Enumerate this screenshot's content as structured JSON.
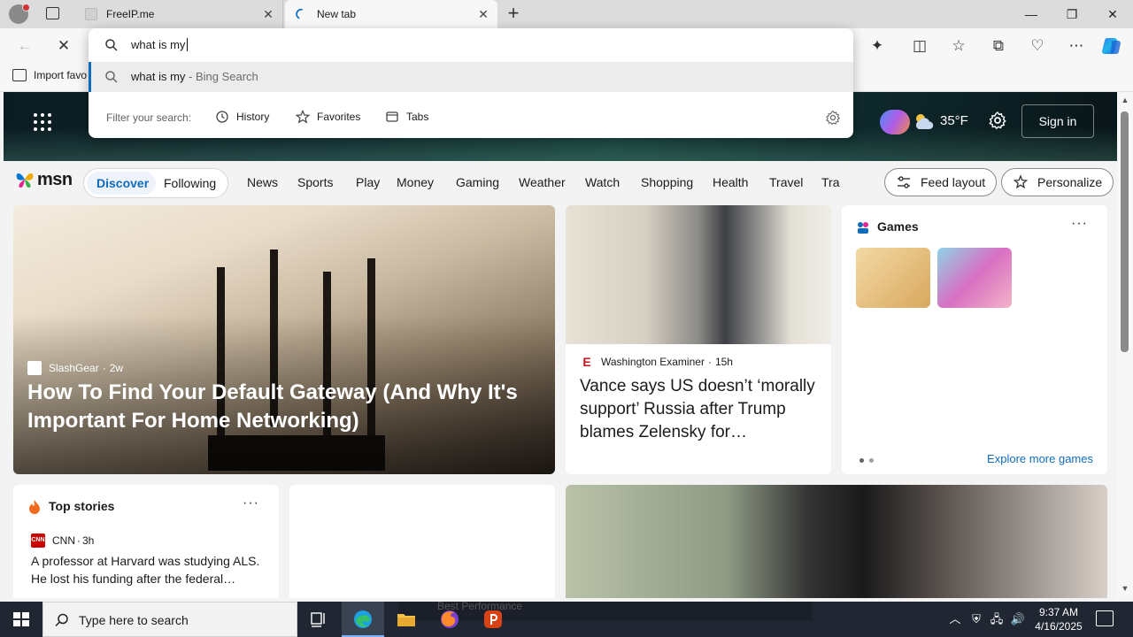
{
  "browser": {
    "tabs": [
      {
        "title": "FreeIP.me"
      },
      {
        "title": "New tab"
      }
    ],
    "favorites_bar": {
      "import_label": "Import favo"
    }
  },
  "omnibox": {
    "query": "what is my",
    "suggestion": {
      "query": "what is my",
      "suffix": " - Bing Search"
    },
    "filter_label": "Filter your search:",
    "filters": [
      {
        "label": "History",
        "icon": "history-icon"
      },
      {
        "label": "Favorites",
        "icon": "star-icon"
      },
      {
        "label": "Tabs",
        "icon": "tabs-icon"
      }
    ]
  },
  "msn": {
    "logo": "msn",
    "weather": {
      "temp": "35°F"
    },
    "signin_label": "Sign in",
    "segment": {
      "active": "Discover",
      "inactive": "Following"
    },
    "nav": [
      "News",
      "Sports",
      "Play",
      "Money",
      "Gaming",
      "Weather",
      "Watch",
      "Shopping",
      "Health",
      "Travel",
      "Tra"
    ],
    "feed_layout_label": "Feed layout",
    "personalize_label": "Personalize",
    "main_story": {
      "source": "SlashGear",
      "age": "2w",
      "headline": "How To Find Your Default Gateway (And Why It's Important For Home Networking)"
    },
    "news_story": {
      "source": "Washington Examiner",
      "age": "15h",
      "headline": "Vance says US doesn’t ‘morally support’ Russia after Trump blames Zelensky for…"
    },
    "games": {
      "title": "Games",
      "more": "···",
      "explore_label": "Explore more games"
    },
    "top_stories": {
      "title": "Top stories",
      "more": "···",
      "source": "CNN",
      "age": "3h",
      "headline": "A professor at Harvard was studying ALS. He lost his funding after the federal…"
    }
  },
  "taskbar": {
    "search_placeholder": "Type here to search",
    "ghost_text": "Best Performance",
    "time": "9:37 AM",
    "date": "4/16/2025"
  },
  "colors": {
    "accent": "#0f6cbd",
    "taskbar": "#202733"
  }
}
